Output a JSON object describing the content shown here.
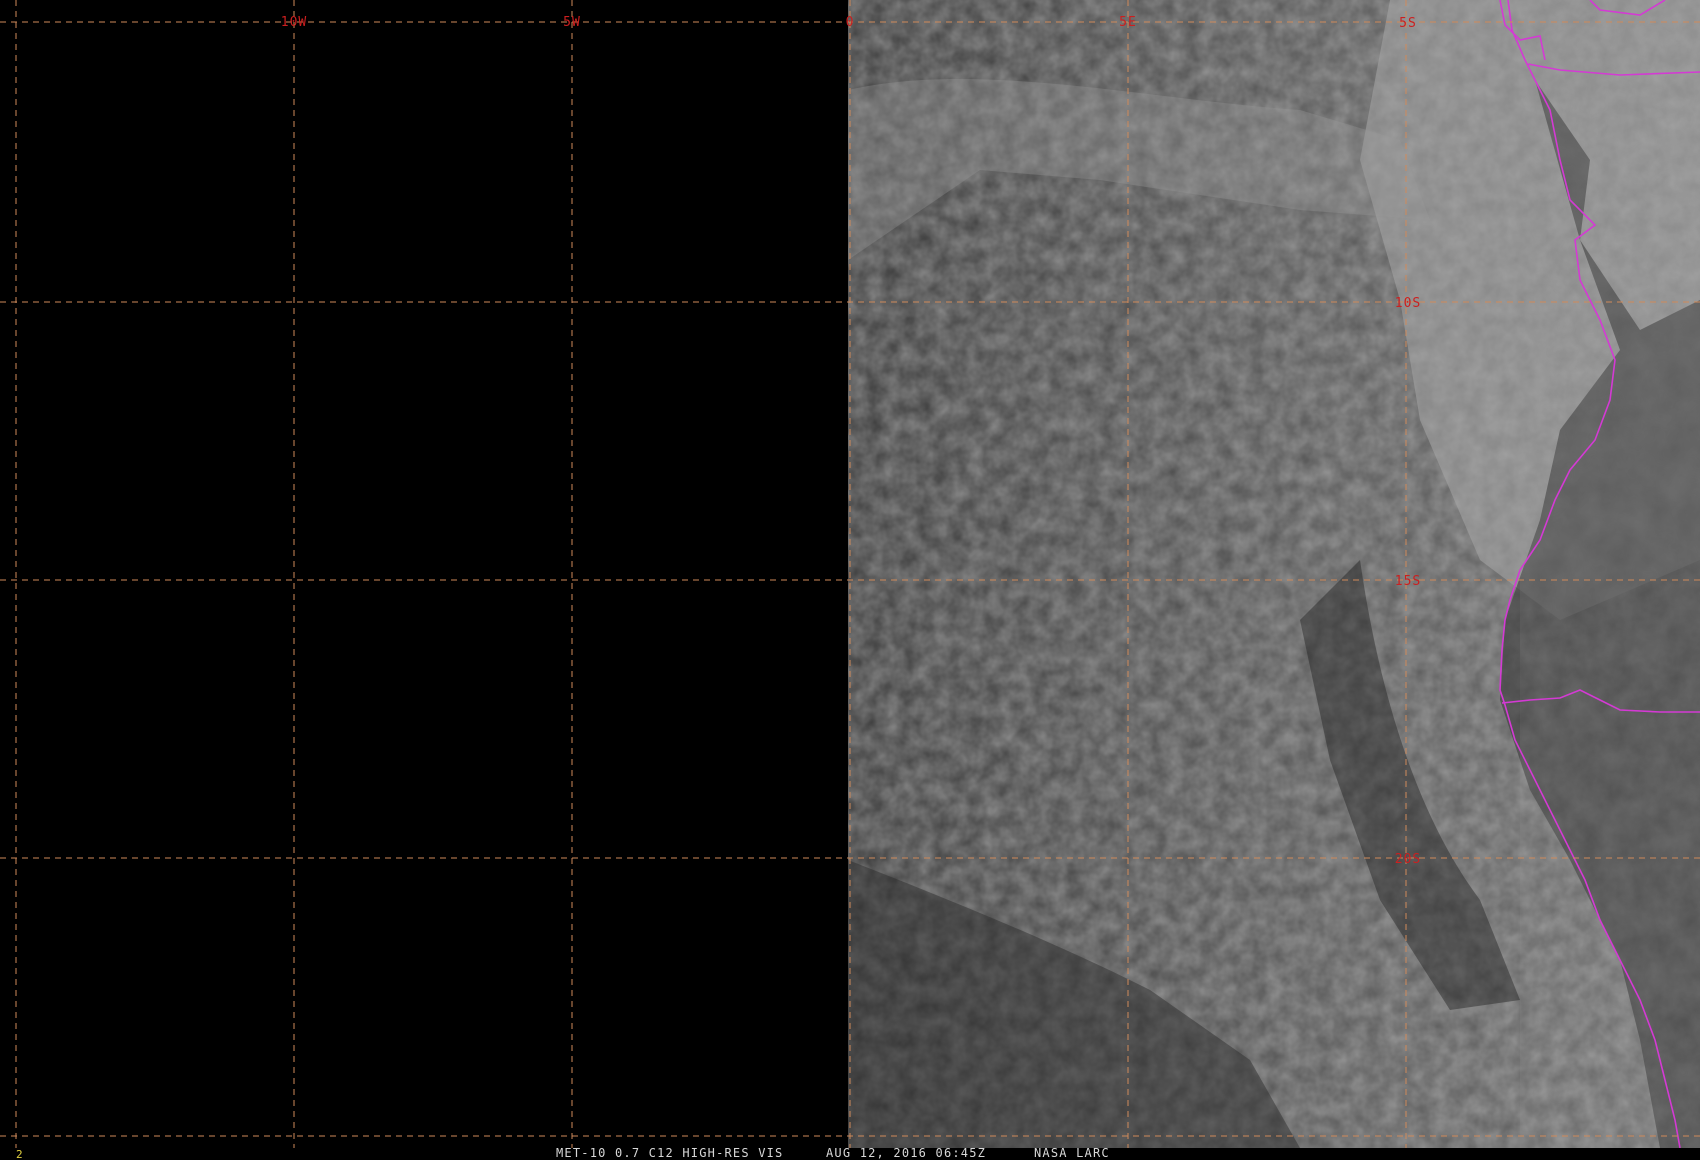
{
  "map": {
    "grid": {
      "longitudes": [
        {
          "label": "10W"
        },
        {
          "label": "5W"
        },
        {
          "label": "0"
        },
        {
          "label": "5E"
        }
      ],
      "latitudes": [
        {
          "label": "5S"
        },
        {
          "label": "10S"
        },
        {
          "label": "15S"
        },
        {
          "label": "20S"
        }
      ]
    },
    "colors": {
      "grid": "#d08a5a",
      "grid_label": "#cc1f1f",
      "political_border": "#d43ad4",
      "no_data": "#000000",
      "status_text": "#d8d8d8"
    }
  },
  "status_bar": {
    "frame_number": "2",
    "product": "MET-10 0.7 C12 HIGH-RES VIS",
    "datetime": "AUG 12, 2016 06:45Z",
    "source": "NASA LARC"
  }
}
